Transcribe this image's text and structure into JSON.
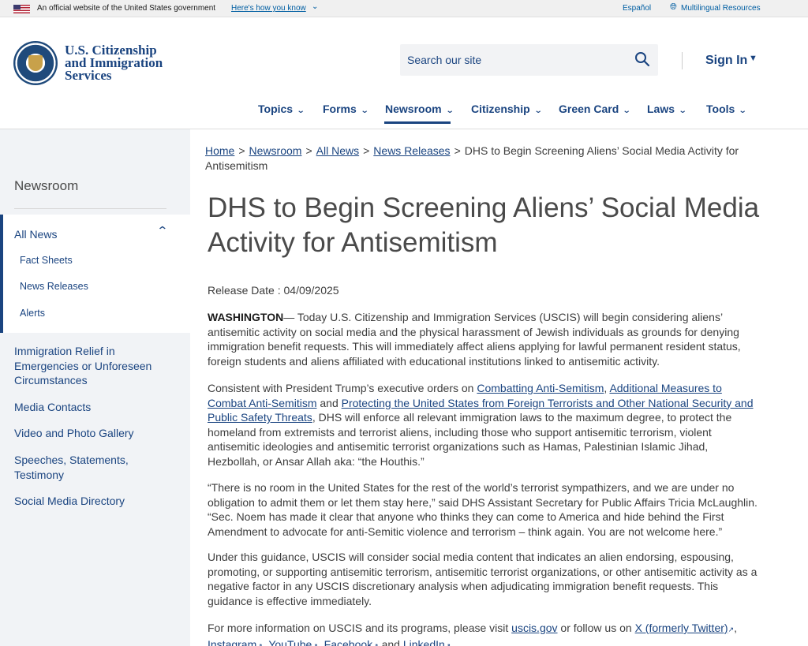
{
  "gov_banner": {
    "text": "An official website of the United States government",
    "link": "Here's how you know",
    "espanol": "Español",
    "multilingual": "Multilingual Resources"
  },
  "header": {
    "logo_lines": [
      "U.S. Citizenship",
      "and Immigration",
      "Services"
    ],
    "search_placeholder": "Search our site",
    "sign_in": "Sign In"
  },
  "nav": {
    "items": [
      "Topics",
      "Forms",
      "Newsroom",
      "Citizenship",
      "Green Card",
      "Laws",
      "Tools"
    ],
    "active": "Newsroom"
  },
  "sidebar": {
    "title": "Newsroom",
    "all_news": "All News",
    "sub_items": [
      "Fact Sheets",
      "News Releases",
      "Alerts"
    ],
    "links": [
      "Immigration Relief in Emergencies or Unforeseen Circumstances",
      "Media Contacts",
      "Video and Photo Gallery",
      "Speeches, Statements, Testimony",
      "Social Media Directory"
    ]
  },
  "breadcrumbs": {
    "items": [
      "Home",
      "Newsroom",
      "All News",
      "News Releases"
    ],
    "current": "DHS to Begin Screening Aliens’ Social Media Activity for Antisemitism"
  },
  "article": {
    "title": "DHS to Begin Screening Aliens’ Social Media Activity for Antisemitism",
    "release_label": "Release Date : ",
    "release_date": "04/09/2025",
    "p1_lead": "WASHINGTON",
    "p1": "— Today U.S. Citizenship and Immigration Services (USCIS) will begin considering aliens’ antisemitic activity on social media and the physical harassment of Jewish individuals as grounds for denying immigration benefit requests. This will immediately affect aliens applying for lawful permanent resident status, foreign students and aliens affiliated with educational institutions linked to antisemitic activity.",
    "p2_a": "Consistent with President Trump’s executive orders on ",
    "p2_link1": "Combatting Anti-Semitism",
    "p2_b": ", ",
    "p2_link2": "Additional Measures to Combat Anti-Semitism",
    "p2_c": " and ",
    "p2_link3": "Protecting the United States from Foreign Terrorists and Other National Security and Public Safety Threats",
    "p2_d": ", DHS will enforce all relevant immigration laws to the maximum degree, to protect the homeland from extremists and terrorist aliens, including those who support antisemitic terrorism, violent antisemitic ideologies and antisemitic terrorist organizations such as Hamas, Palestinian Islamic Jihad, Hezbollah, or Ansar Allah aka: “the Houthis.”",
    "p3": "“There is no room in the United States for the rest of the world’s terrorist sympathizers, and we are under no obligation to admit them or let them stay here,” said DHS Assistant Secretary for Public Affairs Tricia McLaughlin. “Sec. Noem has made it clear that anyone who thinks they can come to America and hide behind the First Amendment to advocate for anti-Semitic violence and terrorism – think again. You are not welcome here.”",
    "p4": "Under this guidance, USCIS will consider social media content that indicates an alien endorsing, espousing, promoting, or supporting antisemitic terrorism, antisemitic terrorist organizations, or other antisemitic activity as a negative factor in any USCIS discretionary analysis when adjudicating immigration benefit requests. This guidance is effective immediately.",
    "p5_a": "For more information on USCIS and its programs, please visit ",
    "p5_link1": "uscis.gov",
    "p5_b": " or follow us on ",
    "p5_link2": "X (formerly Twitter)",
    "p5_link3": "Instagram",
    "p5_link4": "YouTube",
    "p5_link5": "Facebook",
    "p5_c": " and ",
    "p5_link6": "LinkedIn"
  },
  "colors": {
    "primary": "#1a4480",
    "link": "#005ea2",
    "sidebar_bg": "#f1f3f6"
  }
}
